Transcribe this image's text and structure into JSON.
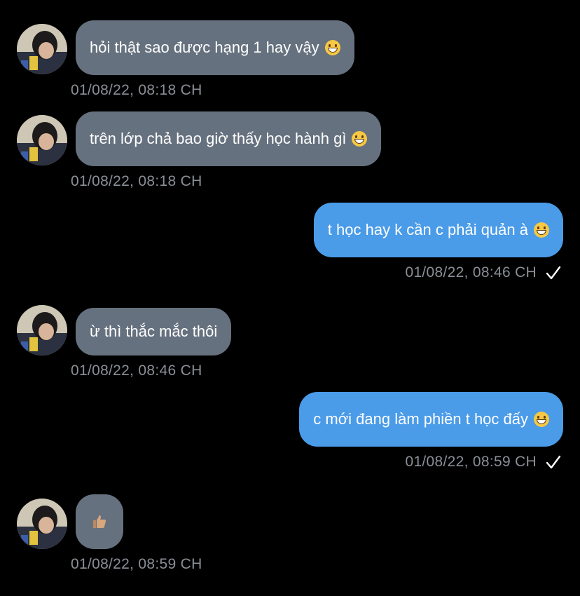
{
  "messages": [
    {
      "direction": "in",
      "text": "hỏi thật sao được hạng 1 hay vậy",
      "emoji": "grinning-face-icon",
      "time": "01/08/22, 08:18 CH"
    },
    {
      "direction": "in",
      "text": "trên lớp chả bao giờ thấy học hành gì",
      "emoji": "grinning-face-icon",
      "time": "01/08/22, 08:18 CH"
    },
    {
      "direction": "out",
      "text": "t học hay k cần c phải quản à",
      "emoji": "grinning-face-icon",
      "time": "01/08/22, 08:46 CH",
      "status": "sent-check-icon"
    },
    {
      "direction": "in",
      "text": "ừ thì thắc mắc thôi",
      "time": "01/08/22, 08:46 CH"
    },
    {
      "direction": "out",
      "text": "c mới đang làm phiền t học đấy",
      "emoji": "grinning-face-icon",
      "time": "01/08/22, 08:59 CH",
      "status": "sent-check-icon"
    },
    {
      "direction": "in",
      "text": "",
      "emoji": "thumbs-up-icon",
      "time": "01/08/22, 08:59 CH"
    }
  ],
  "colors": {
    "background": "#000000",
    "incoming_bubble": "#66717f",
    "outgoing_bubble": "#4a9be8",
    "timestamp": "#8b8f96",
    "text": "#ffffff"
  }
}
